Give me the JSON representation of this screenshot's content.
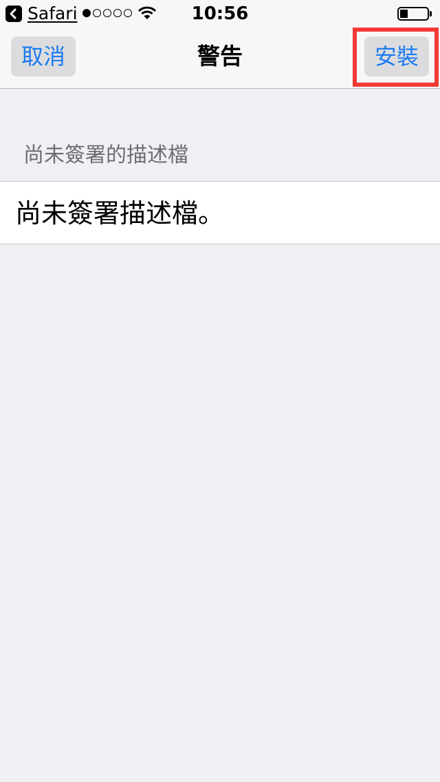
{
  "status_bar": {
    "back_app": "Safari",
    "time": "10:56",
    "signal_strength": 1,
    "signal_max": 5,
    "battery_level": 0.3
  },
  "nav": {
    "cancel_label": "取消",
    "title": "警告",
    "install_label": "安裝",
    "accent_color": "#1a7bf0",
    "highlight_color": "#f33a35"
  },
  "content": {
    "section_header": "尚未簽署的描述檔",
    "cell_text": "尚未簽署描述檔。"
  }
}
